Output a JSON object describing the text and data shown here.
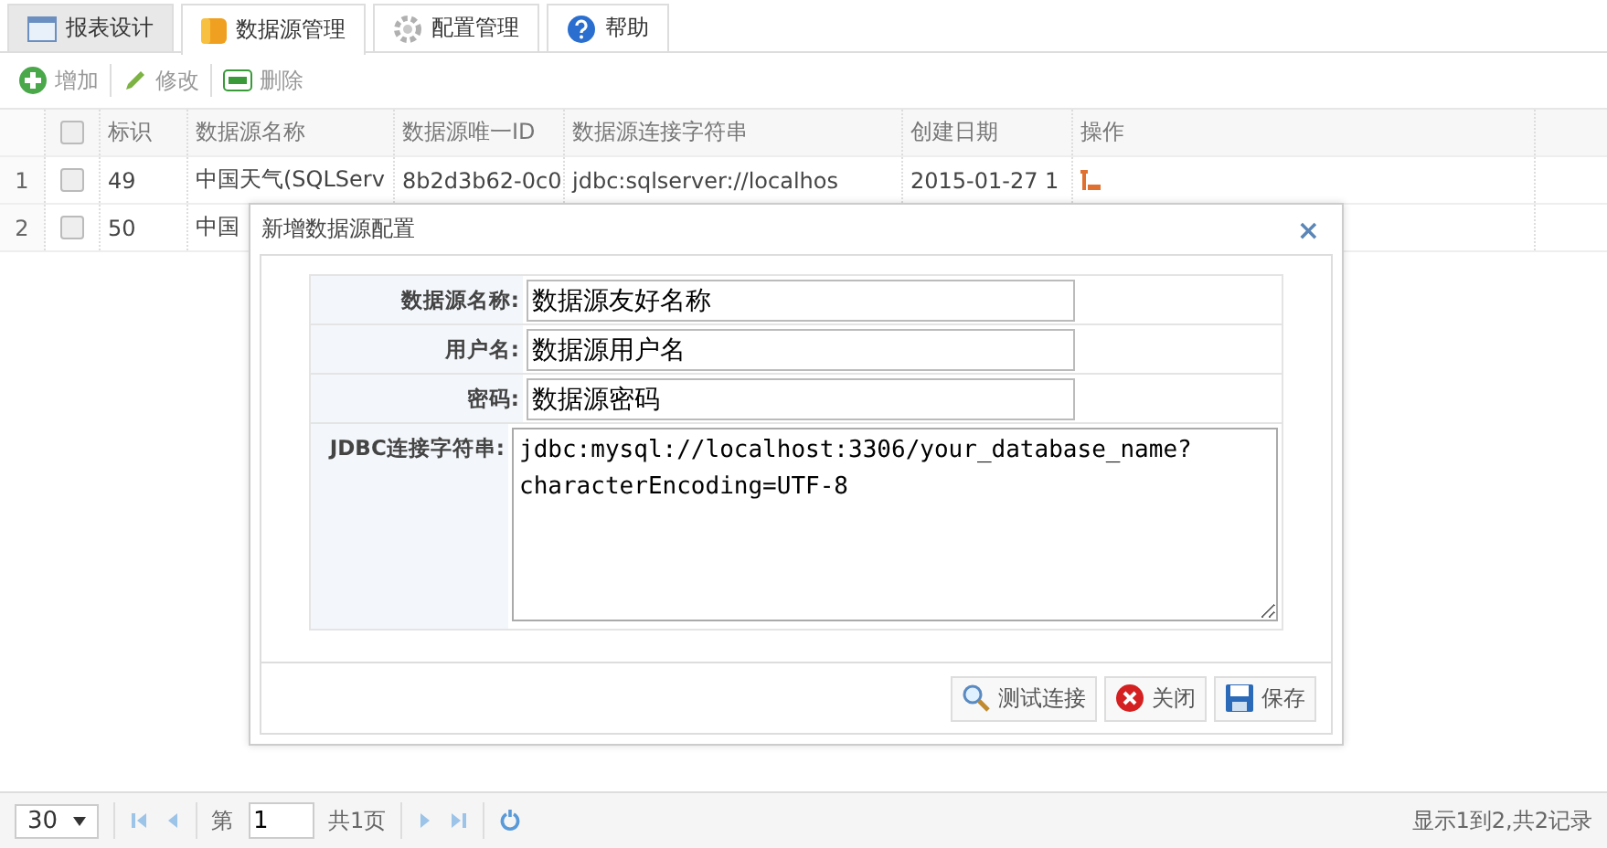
{
  "tabs": [
    {
      "label": "报表设计",
      "selected": false
    },
    {
      "label": "数据源管理",
      "selected": true
    },
    {
      "label": "配置管理",
      "selected": false
    },
    {
      "label": "帮助",
      "selected": false
    }
  ],
  "toolbar": [
    {
      "label": "增加"
    },
    {
      "label": "修改"
    },
    {
      "label": "删除"
    }
  ],
  "table": {
    "all_checked": false,
    "columns": [
      "标识",
      "数据源名称",
      "数据源唯一ID",
      "数据源连接字符串",
      "创建日期",
      "操作"
    ],
    "rows": [
      {
        "number": "1",
        "checked": false,
        "cells": [
          "49",
          "中国天气(SQLServ",
          "8b2d3b62-0c0",
          "jdbc:sqlserver://localhos",
          "2015-01-27 1"
        ]
      },
      {
        "number": "2",
        "checked": false,
        "cells": [
          "50",
          "中国"
        ]
      }
    ]
  },
  "dialog": {
    "title": "新增数据源配置",
    "close": "×",
    "fields": [
      {
        "label": "数据源名称:",
        "value": "数据源友好名称",
        "kind": "input"
      },
      {
        "label": "用户名:",
        "value": "数据源用户名",
        "kind": "input"
      },
      {
        "label": "密码:",
        "value": "数据源密码",
        "kind": "input"
      },
      {
        "label": "JDBC连接字符串:",
        "value": "jdbc:mysql://localhost:3306/your_database_name?characterEncoding=UTF-8",
        "kind": "textarea"
      }
    ],
    "buttons": [
      {
        "label": "测试连接"
      },
      {
        "label": "关闭"
      },
      {
        "label": "保存"
      }
    ]
  },
  "pager": {
    "page_size": "30",
    "page_prefix": "第",
    "page": "1",
    "page_total": "共1页",
    "summary": "显示1到2,共2记录"
  }
}
